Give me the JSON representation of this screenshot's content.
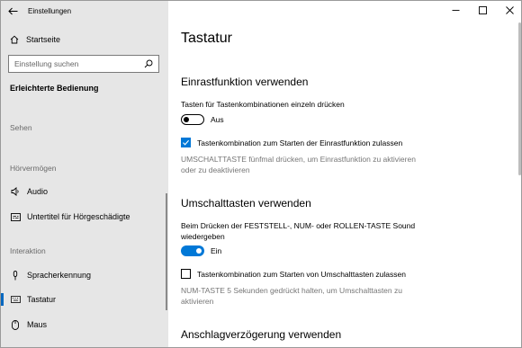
{
  "window": {
    "title": "Einstellungen"
  },
  "sidebar": {
    "home_label": "Startseite",
    "search_placeholder": "Einstellung suchen",
    "section_title": "Erleichterte Bedienung",
    "groups": {
      "see": "Sehen",
      "hear": "Hörvermögen",
      "interaction": "Interaktion"
    },
    "items": [
      {
        "label": "Audio",
        "icon": "speaker-icon"
      },
      {
        "label": "Untertitel für Hörgeschädigte",
        "icon": "captions-icon"
      },
      {
        "label": "Spracherkennung",
        "icon": "microphone-icon"
      },
      {
        "label": "Tastatur",
        "icon": "keyboard-icon",
        "selected": true
      },
      {
        "label": "Maus",
        "icon": "mouse-icon"
      }
    ]
  },
  "main": {
    "page_title": "Tastatur",
    "sticky_keys": {
      "heading": "Einrastfunktion verwenden",
      "toggle_label": "Tasten für Tastenkombinationen einzeln drücken",
      "toggle_state": "Aus",
      "toggle_on": false,
      "checkbox_label": "Tastenkombination zum Starten der Einrastfunktion zulassen",
      "checkbox_checked": true,
      "description": "UMSCHALTTASTE fünfmal drücken, um Einrastfunktion zu aktivieren oder zu deaktivieren"
    },
    "toggle_keys": {
      "heading": "Umschalttasten verwenden",
      "toggle_label": "Beim Drücken der FESTSTELL-, NUM- oder ROLLEN-TASTE Sound wiedergeben",
      "toggle_state": "Ein",
      "toggle_on": true,
      "checkbox_label": "Tastenkombination zum Starten von Umschalttasten zulassen",
      "checkbox_checked": false,
      "description": "NUM-TASTE 5 Sekunden gedrückt halten, um Umschalttasten zu aktivieren"
    },
    "filter_keys": {
      "heading": "Anschlagverzögerung verwenden"
    }
  },
  "colors": {
    "accent": "#0078d7",
    "sidebar_bg": "#e6e6e6",
    "muted_text": "#767676"
  }
}
